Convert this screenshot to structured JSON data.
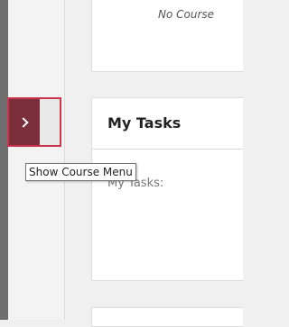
{
  "modules": {
    "top": {
      "message": "No Course"
    },
    "my_tasks": {
      "title": "My Tasks",
      "body_text": "My Tasks:"
    }
  },
  "course_menu_toggle": {
    "tooltip": "Show Course Menu",
    "icon": "chevron-right-icon"
  },
  "colors": {
    "toggle_accent": "#c9354a",
    "toggle_tab": "#7a2f3a"
  }
}
